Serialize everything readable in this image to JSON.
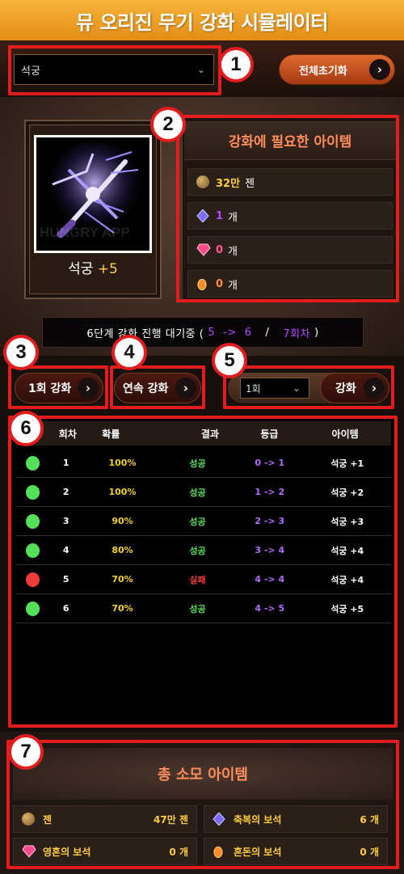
{
  "header": {
    "title": "뮤 오리진 무기 강화 시뮬레이터"
  },
  "controls": {
    "weapon_select": "석궁",
    "reset_label": "전체초기화",
    "single_label": "1회 강화",
    "continuous_label": "연속 강화",
    "count_select": "1회",
    "enhance_label": "강화"
  },
  "badges": [
    "1",
    "2",
    "3",
    "4",
    "5",
    "6",
    "7"
  ],
  "item": {
    "name": "석궁",
    "level": "+5",
    "watermark": "HUNGRY APP"
  },
  "required": {
    "title": "강화에 필요한 아이템",
    "rows": [
      {
        "value": "32만",
        "unit": "젠",
        "value_color": "#ffcf3a",
        "icon": "zen-coin-icon"
      },
      {
        "value": "1",
        "unit": "개",
        "value_color": "#b04cff",
        "icon": "bless-jewel-icon"
      },
      {
        "value": "0",
        "unit": "개",
        "value_color": "#ff5a8a",
        "icon": "soul-jewel-icon"
      },
      {
        "value": "0",
        "unit": "개",
        "value_color": "#ff8c2a",
        "icon": "chaos-jewel-icon"
      }
    ]
  },
  "status": {
    "prefix": "6단계 강화 진행 대기중 (",
    "from": "5",
    "arrow": "->",
    "to": "6",
    "sep": "/",
    "count": "7회차",
    "suffix": ")"
  },
  "table": {
    "headers": [
      "회차",
      "확률",
      "결과",
      "등급",
      "아이템"
    ],
    "rows": [
      {
        "n": "1",
        "prob": "100%",
        "result": "성공",
        "ok": true,
        "grade": "0 -> 1",
        "item": "석궁 +1"
      },
      {
        "n": "2",
        "prob": "100%",
        "result": "성공",
        "ok": true,
        "grade": "1 -> 2",
        "item": "석궁 +2"
      },
      {
        "n": "3",
        "prob": "90%",
        "result": "성공",
        "ok": true,
        "grade": "2 -> 3",
        "item": "석궁 +3"
      },
      {
        "n": "4",
        "prob": "80%",
        "result": "성공",
        "ok": true,
        "grade": "3 -> 4",
        "item": "석궁 +4"
      },
      {
        "n": "5",
        "prob": "70%",
        "result": "실패",
        "ok": false,
        "grade": "4 -> 4",
        "item": "석궁 +4"
      },
      {
        "n": "6",
        "prob": "70%",
        "result": "성공",
        "ok": true,
        "grade": "4 -> 5",
        "item": "석궁 +5"
      }
    ]
  },
  "summary": {
    "title": "총 소모 아이템",
    "cells": [
      {
        "label": "젠",
        "value": "47만 젠",
        "icon": "zen-coin-icon"
      },
      {
        "label": "축복의 보석",
        "value": "6 개",
        "icon": "bless-jewel-icon"
      },
      {
        "label": "영혼의 보석",
        "value": "0 개",
        "icon": "soul-jewel-icon"
      },
      {
        "label": "혼돈의 보석",
        "value": "0 개",
        "icon": "chaos-jewel-icon"
      }
    ]
  },
  "colors": {
    "accent": "#e31d1d",
    "header": "#f0a12a",
    "success": "#55e05a",
    "fail": "#f03c3c"
  }
}
